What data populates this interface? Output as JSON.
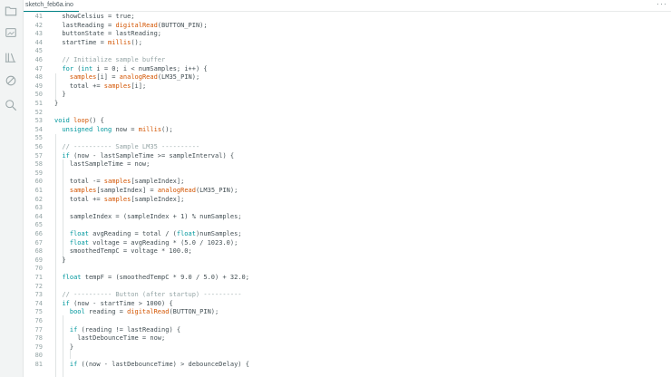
{
  "tab": {
    "filename": "sketch_feb6a.ino",
    "menu": "···"
  },
  "sidebar": [
    "folder-icon",
    "board-icon",
    "library-icon",
    "debug-icon",
    "search-icon"
  ],
  "colors": {
    "keyword": "#00979d",
    "function": "#d35400",
    "comment": "#95a5a6",
    "text": "#434f54"
  },
  "lines": [
    {
      "n": "41",
      "tokens": [
        [
          "  showCelsius = true;",
          ""
        ]
      ]
    },
    {
      "n": "42",
      "tokens": [
        [
          "  lastReading = ",
          ""
        ],
        [
          "digitalRead",
          "fn"
        ],
        [
          "(BUTTON_PIN);",
          ""
        ]
      ]
    },
    {
      "n": "43",
      "tokens": [
        [
          "  buttonState = lastReading;",
          ""
        ]
      ]
    },
    {
      "n": "44",
      "tokens": [
        [
          "  startTime = ",
          ""
        ],
        [
          "millis",
          "fn"
        ],
        [
          "();",
          ""
        ]
      ]
    },
    {
      "n": "45",
      "tokens": []
    },
    {
      "n": "46",
      "tokens": [
        [
          "  // Initialize sample buffer",
          "cm"
        ]
      ]
    },
    {
      "n": "47",
      "tokens": [
        [
          "  ",
          ""
        ],
        [
          "for",
          "kw"
        ],
        [
          " (",
          ""
        ],
        [
          "int",
          "kw"
        ],
        [
          " i = 0; i < numSamples; i++) {",
          ""
        ]
      ]
    },
    {
      "n": "48",
      "tokens": [
        [
          "    ",
          ""
        ],
        [
          "samples",
          "fn"
        ],
        [
          "[i] = ",
          ""
        ],
        [
          "analogRead",
          "fn"
        ],
        [
          "(LM35_PIN);",
          ""
        ]
      ]
    },
    {
      "n": "49",
      "tokens": [
        [
          "    total += ",
          ""
        ],
        [
          "samples",
          "fn"
        ],
        [
          "[i];",
          ""
        ]
      ]
    },
    {
      "n": "50",
      "tokens": [
        [
          "  }",
          ""
        ]
      ]
    },
    {
      "n": "51",
      "tokens": [
        [
          "}",
          ""
        ]
      ]
    },
    {
      "n": "52",
      "tokens": []
    },
    {
      "n": "53",
      "tokens": [
        [
          "void",
          "kw"
        ],
        [
          " ",
          ""
        ],
        [
          "loop",
          "fn"
        ],
        [
          "() {",
          ""
        ]
      ]
    },
    {
      "n": "54",
      "tokens": [
        [
          "  ",
          ""
        ],
        [
          "unsigned",
          "kw"
        ],
        [
          " ",
          ""
        ],
        [
          "long",
          "kw"
        ],
        [
          " now = ",
          ""
        ],
        [
          "millis",
          "fn"
        ],
        [
          "();",
          ""
        ]
      ]
    },
    {
      "n": "55",
      "tokens": []
    },
    {
      "n": "56",
      "tokens": [
        [
          "  // ---------- Sample LM35 ----------",
          "cm"
        ]
      ]
    },
    {
      "n": "57",
      "tokens": [
        [
          "  ",
          ""
        ],
        [
          "if",
          "kw"
        ],
        [
          " (now - lastSampleTime >= sampleInterval) {",
          ""
        ]
      ]
    },
    {
      "n": "58",
      "tokens": [
        [
          "    lastSampleTime = now;",
          ""
        ]
      ]
    },
    {
      "n": "59",
      "tokens": []
    },
    {
      "n": "60",
      "tokens": [
        [
          "    total -= ",
          ""
        ],
        [
          "samples",
          "fn"
        ],
        [
          "[sampleIndex];",
          ""
        ]
      ]
    },
    {
      "n": "61",
      "tokens": [
        [
          "    ",
          ""
        ],
        [
          "samples",
          "fn"
        ],
        [
          "[sampleIndex] = ",
          ""
        ],
        [
          "analogRead",
          "fn"
        ],
        [
          "(LM35_PIN);",
          ""
        ]
      ]
    },
    {
      "n": "62",
      "tokens": [
        [
          "    total += ",
          ""
        ],
        [
          "samples",
          "fn"
        ],
        [
          "[sampleIndex];",
          ""
        ]
      ]
    },
    {
      "n": "63",
      "tokens": []
    },
    {
      "n": "64",
      "tokens": [
        [
          "    sampleIndex = (sampleIndex + 1) % numSamples;",
          ""
        ]
      ]
    },
    {
      "n": "65",
      "tokens": []
    },
    {
      "n": "66",
      "tokens": [
        [
          "    ",
          ""
        ],
        [
          "float",
          "kw"
        ],
        [
          " avgReading = total / (",
          ""
        ],
        [
          "float",
          "kw"
        ],
        [
          ")numSamples;",
          ""
        ]
      ]
    },
    {
      "n": "67",
      "tokens": [
        [
          "    ",
          ""
        ],
        [
          "float",
          "kw"
        ],
        [
          " voltage = avgReading * (5.0 / 1023.0);",
          ""
        ]
      ]
    },
    {
      "n": "68",
      "tokens": [
        [
          "    smoothedTempC = voltage * 100.0;",
          ""
        ]
      ]
    },
    {
      "n": "69",
      "tokens": [
        [
          "  }",
          ""
        ]
      ]
    },
    {
      "n": "70",
      "tokens": []
    },
    {
      "n": "71",
      "tokens": [
        [
          "  ",
          ""
        ],
        [
          "float",
          "kw"
        ],
        [
          " tempF = (smoothedTempC * 9.0 / 5.0) + 32.0;",
          ""
        ]
      ]
    },
    {
      "n": "72",
      "tokens": []
    },
    {
      "n": "73",
      "tokens": [
        [
          "  // ---------- Button (after startup) ----------",
          "cm"
        ]
      ]
    },
    {
      "n": "74",
      "tokens": [
        [
          "  ",
          ""
        ],
        [
          "if",
          "kw"
        ],
        [
          " (now - startTime > 1000) {",
          ""
        ]
      ]
    },
    {
      "n": "75",
      "tokens": [
        [
          "    ",
          ""
        ],
        [
          "bool",
          "kw"
        ],
        [
          " reading = ",
          ""
        ],
        [
          "digitalRead",
          "fn"
        ],
        [
          "(BUTTON_PIN);",
          ""
        ]
      ]
    },
    {
      "n": "76",
      "tokens": []
    },
    {
      "n": "77",
      "tokens": [
        [
          "    ",
          ""
        ],
        [
          "if",
          "kw"
        ],
        [
          " (reading != lastReading) {",
          ""
        ]
      ]
    },
    {
      "n": "78",
      "tokens": [
        [
          "      lastDebounceTime = now;",
          ""
        ]
      ]
    },
    {
      "n": "79",
      "tokens": [
        [
          "    }",
          ""
        ]
      ]
    },
    {
      "n": "80",
      "tokens": []
    },
    {
      "n": "81",
      "tokens": [
        [
          "    ",
          ""
        ],
        [
          "if",
          "kw"
        ],
        [
          " ((now - lastDebounceTime) > debounceDelay) {",
          ""
        ]
      ]
    }
  ]
}
